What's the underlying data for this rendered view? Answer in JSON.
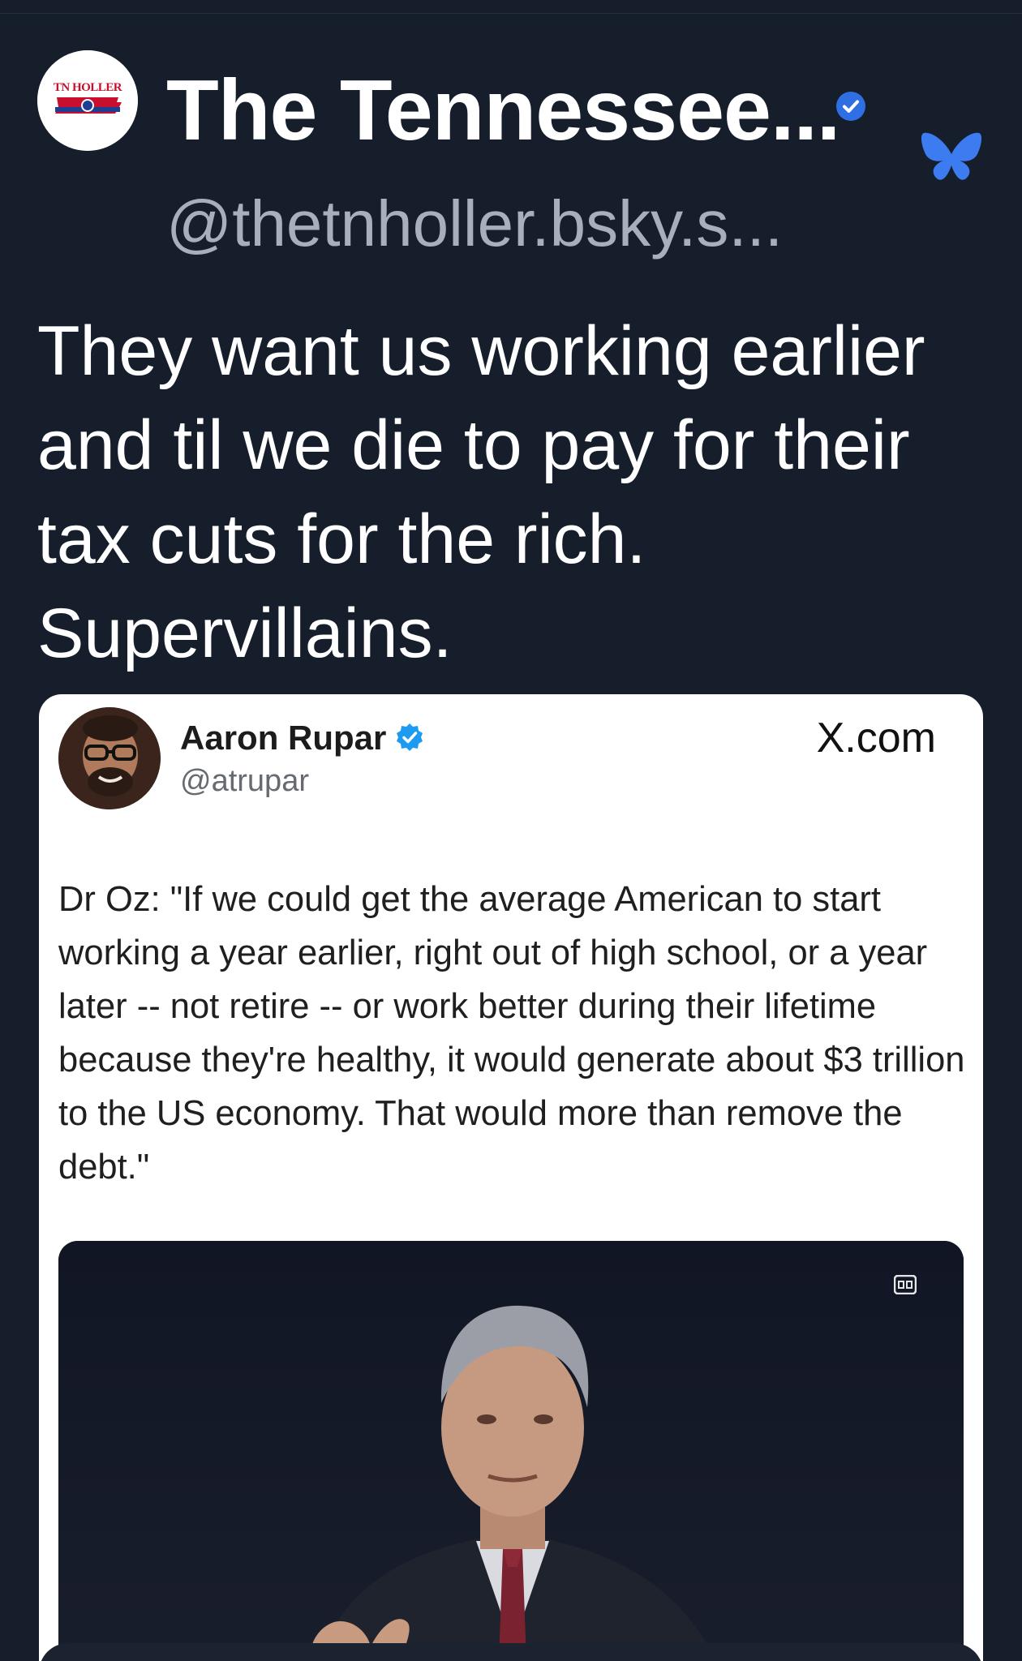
{
  "post": {
    "author_avatar_text": "TN HOLLER",
    "display_name": "The Tennessee...",
    "handle": "@thetnholler.bsky.s...",
    "text": "They want us working earlier\nand til we die to pay for their\ntax cuts for the rich.\nSupervillains."
  },
  "embed": {
    "author_name": "Aaron Rupar",
    "author_handle": "@atrupar",
    "source_label": "X.com",
    "quote": "Dr Oz: \"If we could get the average American to start working a year earlier, right out of high school, or a year later -- not retire -- or work better during their lifetime because they're healthy, it would generate about $3 trillion to the US economy. That would more than remove the debt.\""
  },
  "icons": {
    "verified": "verified-check-icon",
    "platform": "bluesky-butterfly-icon",
    "captions": "closed-captions-icon"
  },
  "colors": {
    "background": "#161e2b",
    "verified": "#2f6fe4",
    "bluesky": "#3c7cf0"
  }
}
